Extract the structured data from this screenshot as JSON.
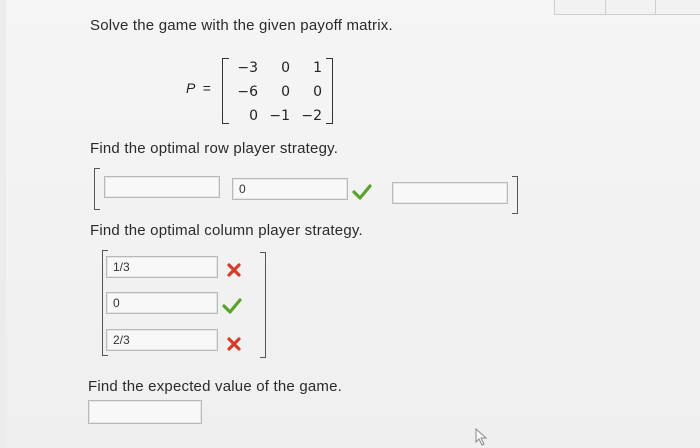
{
  "question": {
    "intro": "Solve the game with the given payoff matrix.",
    "matrix_label": "P",
    "matrix_eq": "=",
    "matrix": [
      [
        "−3",
        "0",
        "1"
      ],
      [
        "−6",
        "0",
        "0"
      ],
      [
        "0",
        "−1",
        "−2"
      ]
    ]
  },
  "row_strategy": {
    "prompt": "Find the optimal row player strategy.",
    "inputs": [
      {
        "value": "",
        "status": "none"
      },
      {
        "value": "0",
        "status": "correct"
      },
      {
        "value": "",
        "status": "none"
      }
    ]
  },
  "column_strategy": {
    "prompt": "Find the optimal column player strategy.",
    "inputs": [
      {
        "value": "1/3",
        "status": "incorrect"
      },
      {
        "value": "0",
        "status": "correct"
      },
      {
        "value": "2/3",
        "status": "incorrect"
      }
    ]
  },
  "expected_value": {
    "prompt": "Find the expected value of the game.",
    "input_value": ""
  },
  "colors": {
    "correct": "#5aa32a",
    "incorrect": "#d93a2b"
  },
  "icons": [
    "checkmark-icon",
    "cross-icon",
    "cursor-icon"
  ]
}
